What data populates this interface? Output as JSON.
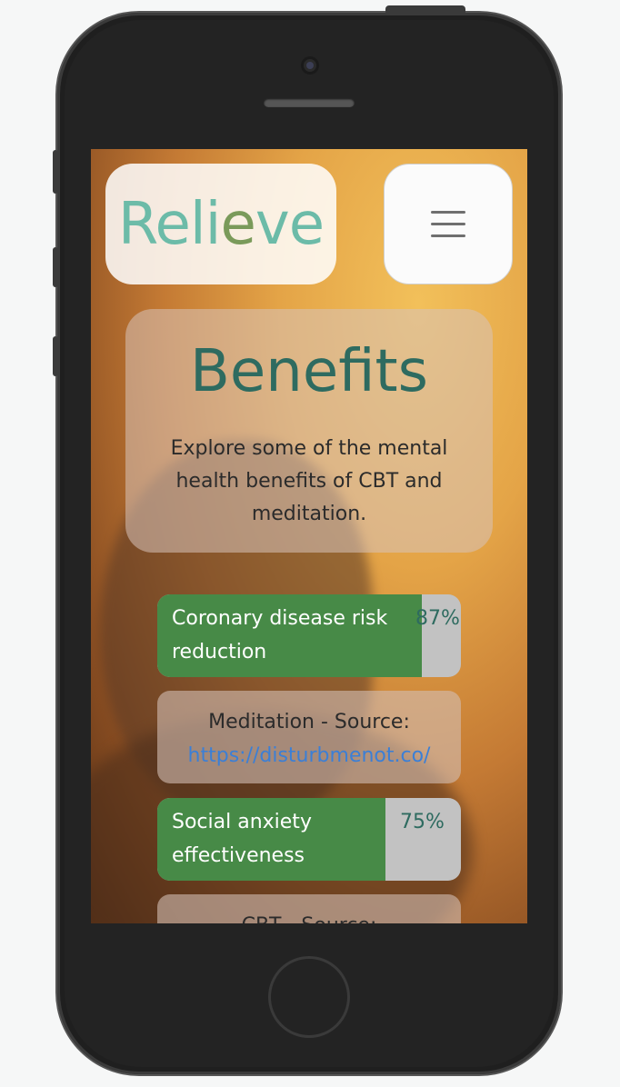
{
  "header": {
    "logo_part1": "Reli",
    "logo_part2": "e",
    "logo_part3": "ve"
  },
  "hero": {
    "title": "Benefits",
    "description": "Explore some of the mental health benefits of CBT and meditation."
  },
  "stats": [
    {
      "label": "Coronary disease risk reduction",
      "percent_text": "87%",
      "percent_value": 87
    },
    {
      "label": "Social anxiety effectiveness",
      "percent_text": "75%",
      "percent_value": 75
    }
  ],
  "sources": [
    {
      "prefix": "Meditation - Source:",
      "link": "https://disturbmenot.co/"
    },
    {
      "prefix": "CBT - Source:"
    }
  ],
  "colors": {
    "accent_green": "#478a47",
    "logo_teal": "#6cbba8",
    "title_teal": "#2e6b60",
    "link_blue": "#3b7fd6"
  }
}
